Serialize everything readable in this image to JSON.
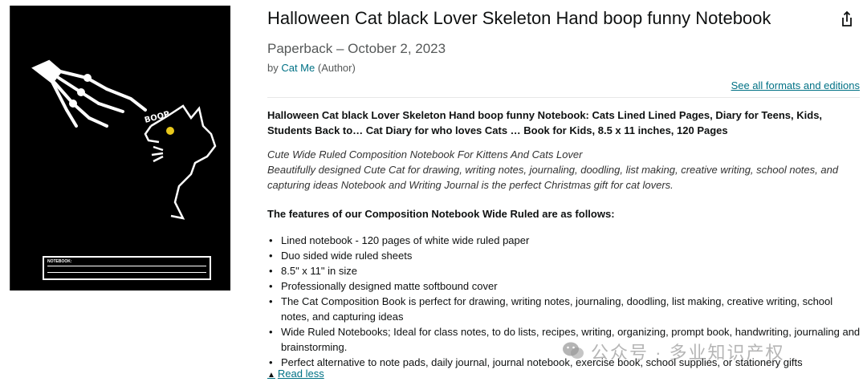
{
  "product": {
    "title": "Halloween Cat black Lover Skeleton Hand boop funny Notebook",
    "format_line": "Paperback – October 2, 2023",
    "by_prefix": "by ",
    "author": "Cat Me",
    "author_role": " (Author)",
    "see_all": "See all formats and editions"
  },
  "cover": {
    "boop_text": "BOOP",
    "notebook_label": "NOTEBOOK:"
  },
  "description": {
    "headline": "Halloween Cat black Lover Skeleton Hand boop funny Notebook: Cats Lined Lined Pages, Diary for Teens, Kids, Students Back to… Cat Diary for who loves Cats … Book for Kids, 8.5 x 11 inches, 120 Pages",
    "italic_1": "Cute Wide Ruled Composition Notebook For Kittens And Cats Lover",
    "italic_2": "Beautifully designed Cute Cat for drawing, writing notes, journaling, doodling, list making, creative writing, school notes, and capturing ideas Notebook and Writing Journal is the perfect Christmas gift for cat lovers.",
    "features_heading": "The features of our Composition Notebook Wide Ruled are as follows:",
    "features": [
      "Lined notebook - 120 pages of white wide ruled paper",
      "Duo sided wide ruled sheets",
      "8.5\" x 11\" in size",
      "Professionally designed matte softbound cover",
      "The Cat Composition Book is perfect for drawing, writing notes, journaling, doodling, list making, creative writing, school notes, and capturing ideas",
      "Wide Ruled Notebooks; Ideal for class notes, to do lists, recipes, writing, organizing, prompt book, handwriting, journaling and brainstorming.",
      "Perfect alternative to note pads, daily journal, journal notebook, exercise book, school supplies, or stationery gifts"
    ],
    "read_less": "Read less"
  },
  "watermark": {
    "text": "公众号 · 多业知识产权"
  },
  "icons": {
    "share": "share-icon",
    "caret": "caret-up-icon",
    "wechat": "wechat-icon"
  }
}
